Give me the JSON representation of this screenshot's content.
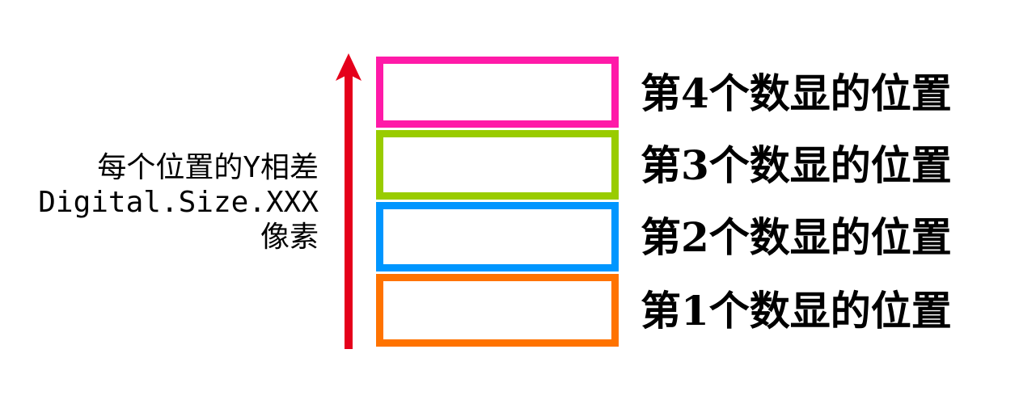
{
  "caption": {
    "line1": "每个位置的Y相差",
    "line2": "Digital.Size.XXX",
    "line3": "像素"
  },
  "arrow": {
    "color": "#e5001b"
  },
  "slots": [
    {
      "label": "第1个数显的位置",
      "color": "#ff7300"
    },
    {
      "label": "第2个数显的位置",
      "color": "#0096ff"
    },
    {
      "label": "第3个数显的位置",
      "color": "#99cc00"
    },
    {
      "label": "第4个数显的位置",
      "color": "#ff1aa8"
    }
  ]
}
